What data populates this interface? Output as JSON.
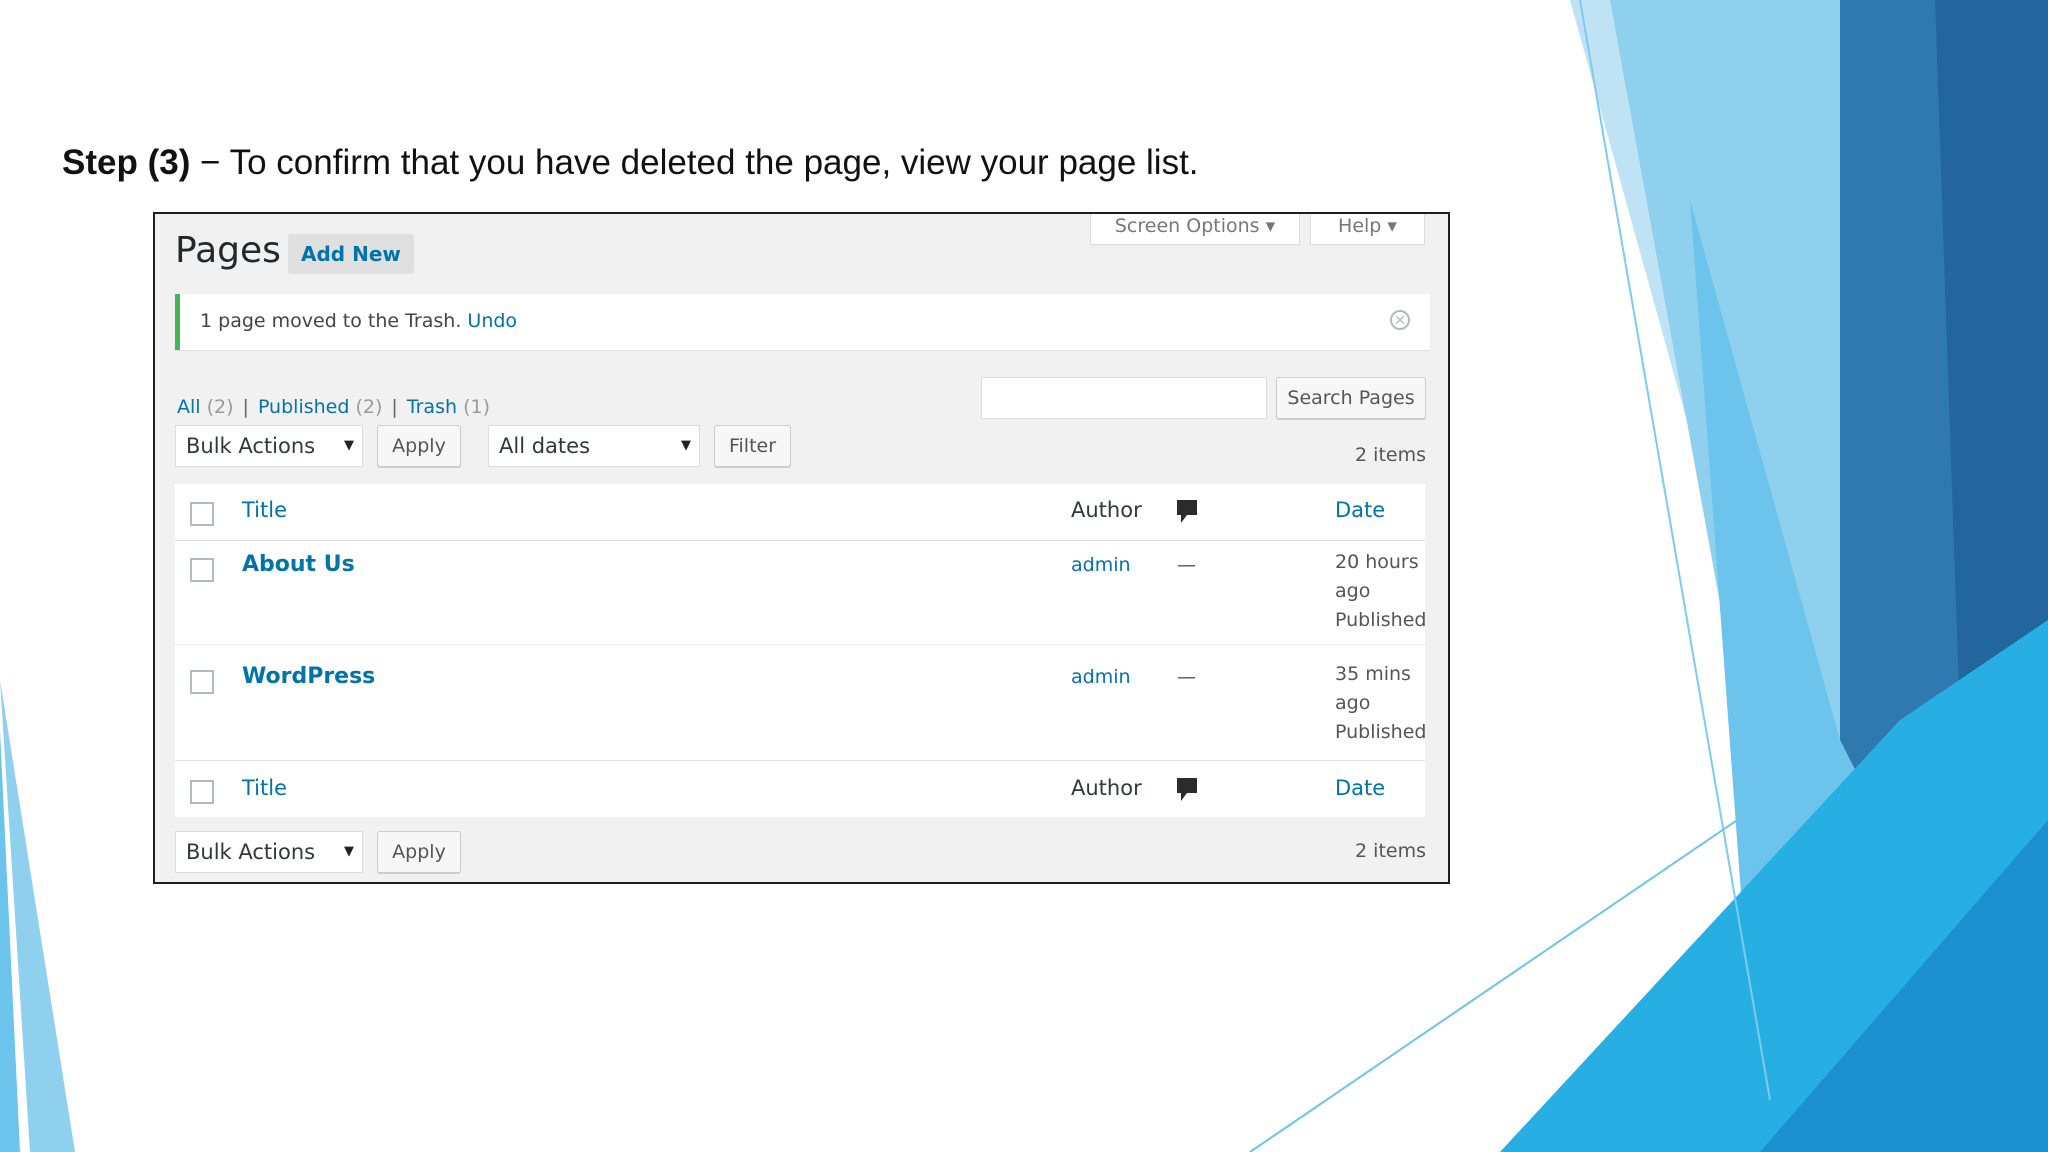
{
  "slide": {
    "step_label": "Step (3)",
    "step_text": " − To confirm that you have deleted the page, view your page list."
  },
  "wp": {
    "page_title": "Pages",
    "add_new_label": "Add New",
    "screen_options_label": "Screen Options ▾",
    "help_label": "Help ▾",
    "notice": {
      "message": "1 page moved to the Trash.",
      "undo_label": "Undo"
    },
    "views": [
      {
        "label": "All",
        "count": "(2)"
      },
      {
        "label": "Published",
        "count": "(2)"
      },
      {
        "label": "Trash",
        "count": "(1)"
      }
    ],
    "search_value": "",
    "search_button": "Search Pages",
    "bulk_actions": "Bulk Actions",
    "apply_label": "Apply",
    "dates_filter": "All dates",
    "filter_label": "Filter",
    "items_count": "2 items",
    "columns": {
      "title": "Title",
      "author": "Author",
      "comments_icon": "comment-bubble-icon",
      "date": "Date"
    },
    "rows": [
      {
        "title": "About Us",
        "author": "admin",
        "comments": "—",
        "date_line1": "20 hours",
        "date_line2": "ago",
        "status": "Published"
      },
      {
        "title": "WordPress",
        "author": "admin",
        "comments": "—",
        "date_line1": "35 mins",
        "date_line2": "ago",
        "status": "Published"
      }
    ]
  },
  "colors": {
    "accent": "#0073aa",
    "notice_success": "#46b450",
    "admin_bg": "#f1f1f1",
    "slide_blue": "#2a7fc0"
  }
}
